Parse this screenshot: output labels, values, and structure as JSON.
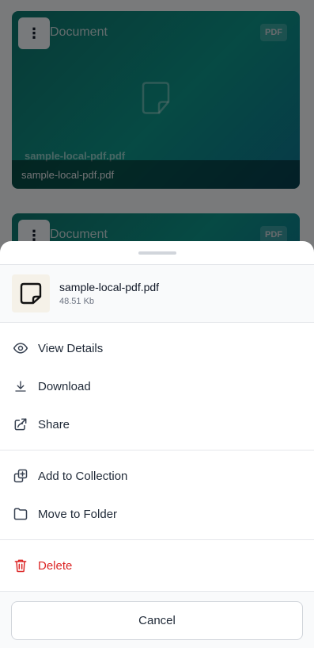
{
  "background_cards": [
    {
      "type_label": "Document",
      "badge": "PDF",
      "file_name": "sample-local-pdf.pdf",
      "footer_name": "sample-local-pdf.pdf"
    },
    {
      "type_label": "Document",
      "badge": "PDF"
    }
  ],
  "sheet": {
    "file": {
      "name": "sample-local-pdf.pdf",
      "size": "48.51 Kb"
    },
    "primary_actions": [
      {
        "label": "View Details",
        "icon": "eye-icon"
      },
      {
        "label": "Download",
        "icon": "download-icon"
      },
      {
        "label": "Share",
        "icon": "share-icon"
      }
    ],
    "secondary_actions": [
      {
        "label": "Add to Collection",
        "icon": "collection-icon"
      },
      {
        "label": "Move to Folder",
        "icon": "folder-icon"
      }
    ],
    "danger_actions": [
      {
        "label": "Delete",
        "icon": "trash-icon",
        "color": "#dc2626"
      }
    ],
    "cancel_label": "Cancel"
  }
}
